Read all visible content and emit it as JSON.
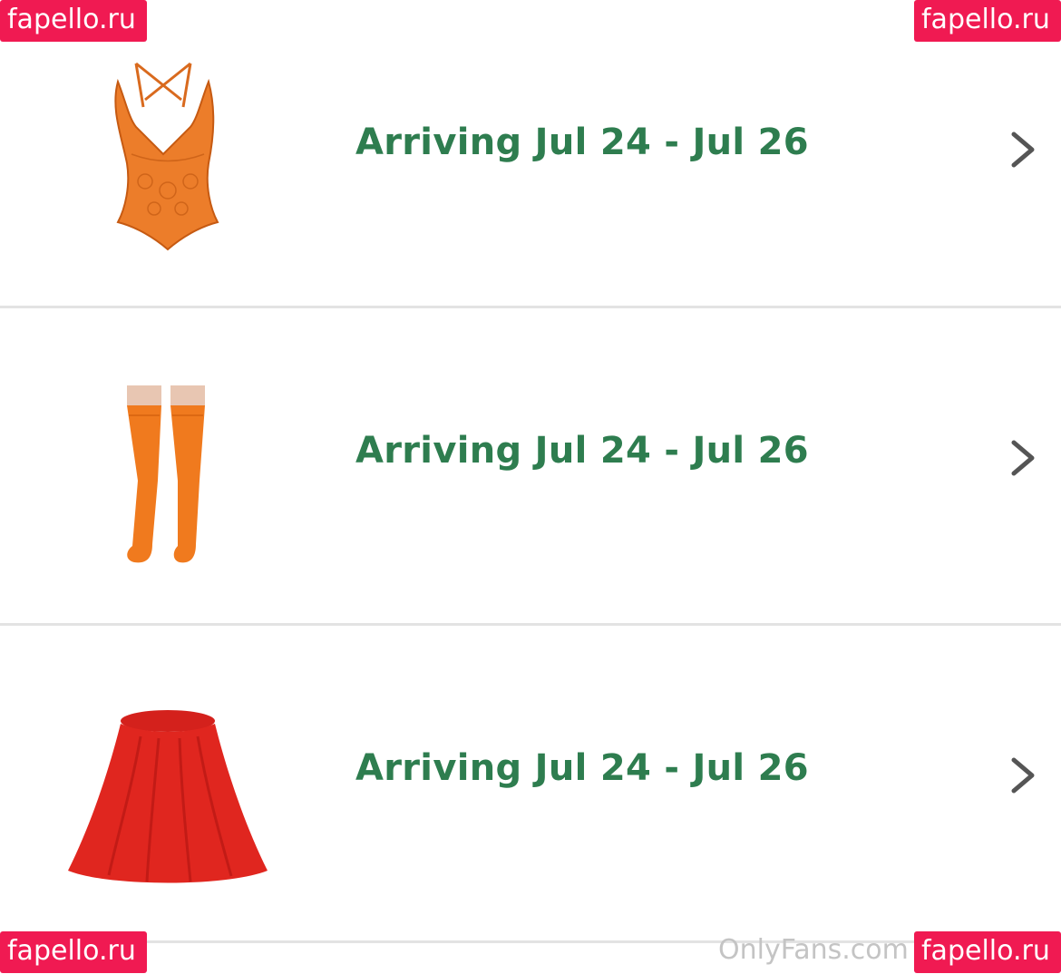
{
  "colors": {
    "delivery_green": "#2e7d4f",
    "chevron_gray": "#555555",
    "divider": "#e3e3e3",
    "watermark_bg": "#f01a52"
  },
  "orders": [
    {
      "product_icon": "orange-lace-bodysuit-thumbnail",
      "delivery_status": "Arriving Jul 24 - Jul 26",
      "chevron_icon": "chevron-right-icon"
    },
    {
      "product_icon": "orange-thigh-high-stockings-thumbnail",
      "delivery_status": "Arriving Jul 24 - Jul 26",
      "chevron_icon": "chevron-right-icon"
    },
    {
      "product_icon": "red-skater-skirt-thumbnail",
      "delivery_status": "Arriving Jul 24 - Jul 26",
      "chevron_icon": "chevron-right-icon"
    }
  ],
  "watermarks": {
    "top_left": "fapello.ru",
    "top_right": "fapello.ru",
    "bottom_left": "fapello.ru",
    "bottom_right": "fapello.ru",
    "onlyfans": "OnlyFans.com"
  }
}
